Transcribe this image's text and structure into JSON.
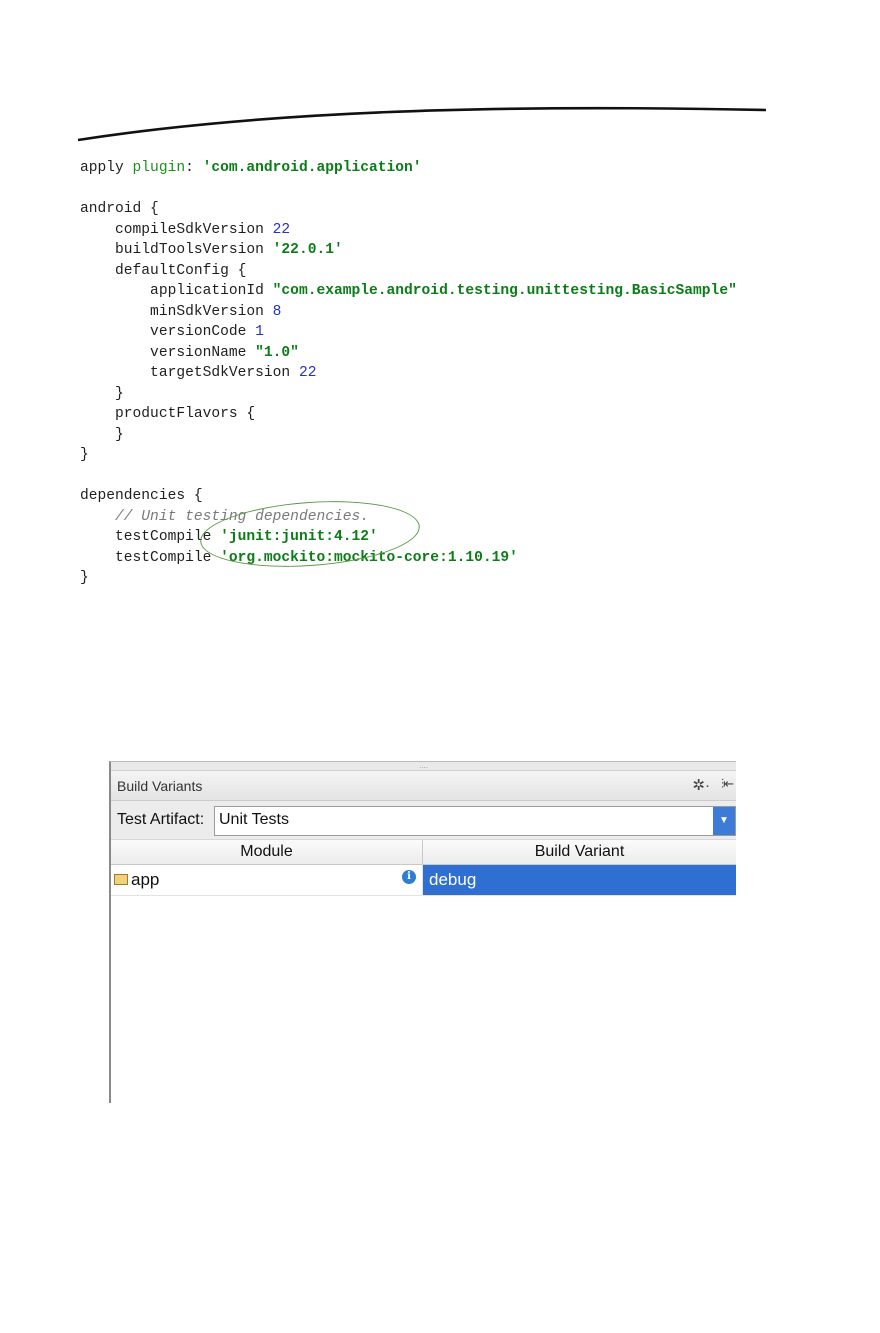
{
  "code_lines": [
    [
      {
        "t": "apply "
      },
      {
        "t": "plugin",
        "c": "kw"
      },
      {
        "t": ": "
      },
      {
        "t": "'com.android.application'",
        "c": "str"
      }
    ],
    [],
    [
      {
        "t": "android {"
      }
    ],
    [
      {
        "t": "    compileSdkVersion "
      },
      {
        "t": "22",
        "c": "num"
      }
    ],
    [
      {
        "t": "    buildToolsVersion "
      },
      {
        "t": "'22.0.1'",
        "c": "str"
      }
    ],
    [
      {
        "t": "    defaultConfig {"
      }
    ],
    [
      {
        "t": "        applicationId "
      },
      {
        "t": "\"com.example.android.testing.unittesting.BasicSample\"",
        "c": "str"
      }
    ],
    [
      {
        "t": "        minSdkVersion "
      },
      {
        "t": "8",
        "c": "num"
      }
    ],
    [
      {
        "t": "        versionCode "
      },
      {
        "t": "1",
        "c": "num"
      }
    ],
    [
      {
        "t": "        versionName "
      },
      {
        "t": "\"1.0\"",
        "c": "str"
      }
    ],
    [
      {
        "t": "        targetSdkVersion "
      },
      {
        "t": "22",
        "c": "num"
      }
    ],
    [
      {
        "t": "    }"
      }
    ],
    [
      {
        "t": "    productFlavors {"
      }
    ],
    [
      {
        "t": "    }"
      }
    ],
    [
      {
        "t": "}"
      }
    ],
    [],
    [
      {
        "t": "dependencies {"
      }
    ],
    [
      {
        "t": "    // Unit testing dependencies.",
        "c": "cmt"
      }
    ],
    [
      {
        "t": "    testCompile "
      },
      {
        "t": "'junit:junit:4.12'",
        "c": "str"
      }
    ],
    [
      {
        "t": "    testCompile "
      },
      {
        "t": "'org.mockito:mockito-core:1.10.19'",
        "c": "str"
      }
    ],
    [
      {
        "t": "}"
      }
    ]
  ],
  "panel": {
    "grip": "....",
    "title": "Build Variants",
    "gear_glyph": "✲·",
    "pin_glyph": "⫶⇤",
    "test_artifact_label": "Test Artifact:",
    "test_artifact_value": "Unit Tests",
    "dropdown_glyph": "▼",
    "columns": {
      "module": "Module",
      "variant": "Build Variant"
    },
    "rows": [
      {
        "module": "app",
        "variant": "debug"
      }
    ]
  },
  "colors": {
    "string": "#0a7d16",
    "number": "#2133c9",
    "selection": "#2e6fd1",
    "annotation_circle": "#5a9a44"
  }
}
